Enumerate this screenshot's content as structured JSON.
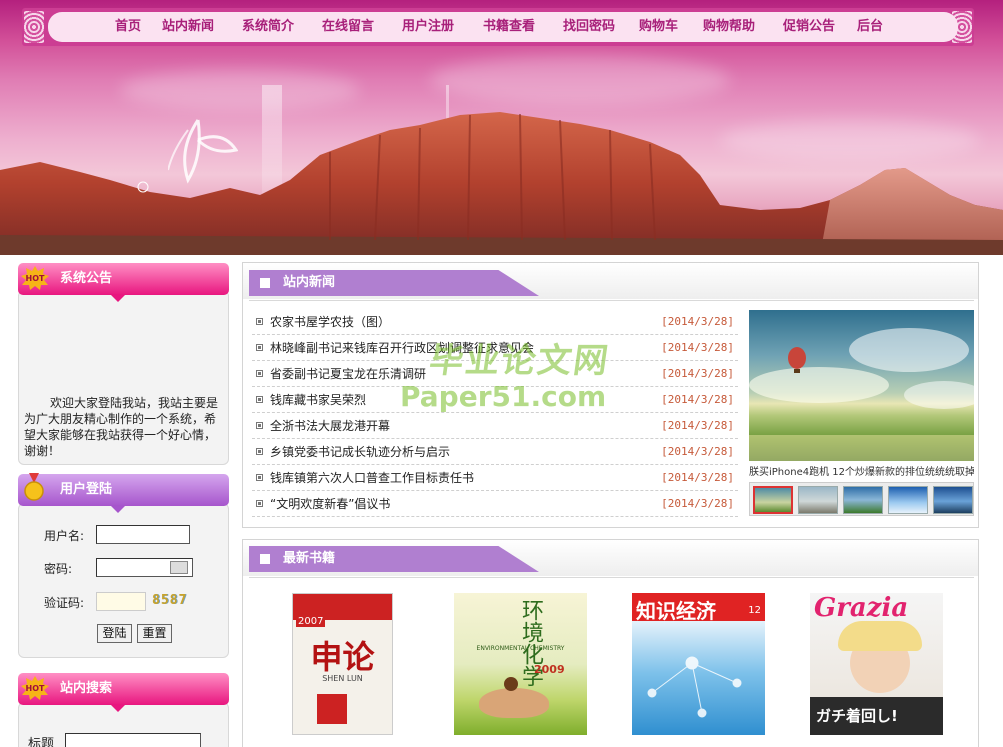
{
  "nav": {
    "items": [
      "首页",
      "站内新闻",
      "系统简介",
      "在线留言",
      "用户注册",
      "书籍查看",
      "找回密码",
      "购物车",
      "购物帮助",
      "促销公告",
      "后台"
    ]
  },
  "notice": {
    "title": "系统公告",
    "badge": "HOT",
    "text": "欢迎大家登陆我站，我站主要是为广大朋友精心制作的一个系统，希望大家能够在我站获得一个好心情，谢谢！"
  },
  "login": {
    "title": "用户登陆",
    "username_label": "用户名:",
    "password_label": "密码:",
    "captcha_label": "验证码:",
    "captcha_value": "8587",
    "login_button": "登陆",
    "reset_button": "重置"
  },
  "search": {
    "title": "站内搜索",
    "badge": "HOT",
    "field_label": "标题"
  },
  "news": {
    "title": "站内新闻",
    "items": [
      {
        "title": "农家书屋学农技（图）",
        "date": "[2014/3/28]"
      },
      {
        "title": "林晓峰副书记来钱库召开行政区划调整征求意见会",
        "date": "[2014/3/28]"
      },
      {
        "title": "省委副书记夏宝龙在乐清调研",
        "date": "[2014/3/28]"
      },
      {
        "title": "钱库藏书家吴荣烈",
        "date": "[2014/3/28]"
      },
      {
        "title": "全浙书法大展龙港开幕",
        "date": "[2014/3/28]"
      },
      {
        "title": "乡镇党委书记成长轨迹分析与启示",
        "date": "[2014/3/28]"
      },
      {
        "title": "钱库镇第六次人口普查工作目标责任书",
        "date": "[2014/3/28]"
      },
      {
        "title": "“文明欢度新春”倡议书",
        "date": "[2014/3/28]"
      }
    ],
    "slide_caption": "朕买iPhone4跑机 12个炒爆新款的排位统统统取掉"
  },
  "watermark": {
    "line1": "毕业论文网",
    "line2": "Paper51.com"
  },
  "books": {
    "title": "最新书籍",
    "items": [
      {
        "cover_title": "申论",
        "cover_sub": "SHEN LUN",
        "year": "2007"
      },
      {
        "cover_title": "环境化学",
        "cover_sub": "ENVIRONMENTAL CHEMISTRY",
        "year": "2009"
      },
      {
        "cover_title": "知识经济",
        "cover_sub": "12"
      },
      {
        "cover_title": "Grazia",
        "cover_sub": "ガチ着回し!"
      }
    ]
  },
  "colors": {
    "nav_text": "#a8207a",
    "header_pink": "#e8167f",
    "header_purple": "#a655cc",
    "section_header": "#b07fd0",
    "date_text": "#c65a3a"
  }
}
